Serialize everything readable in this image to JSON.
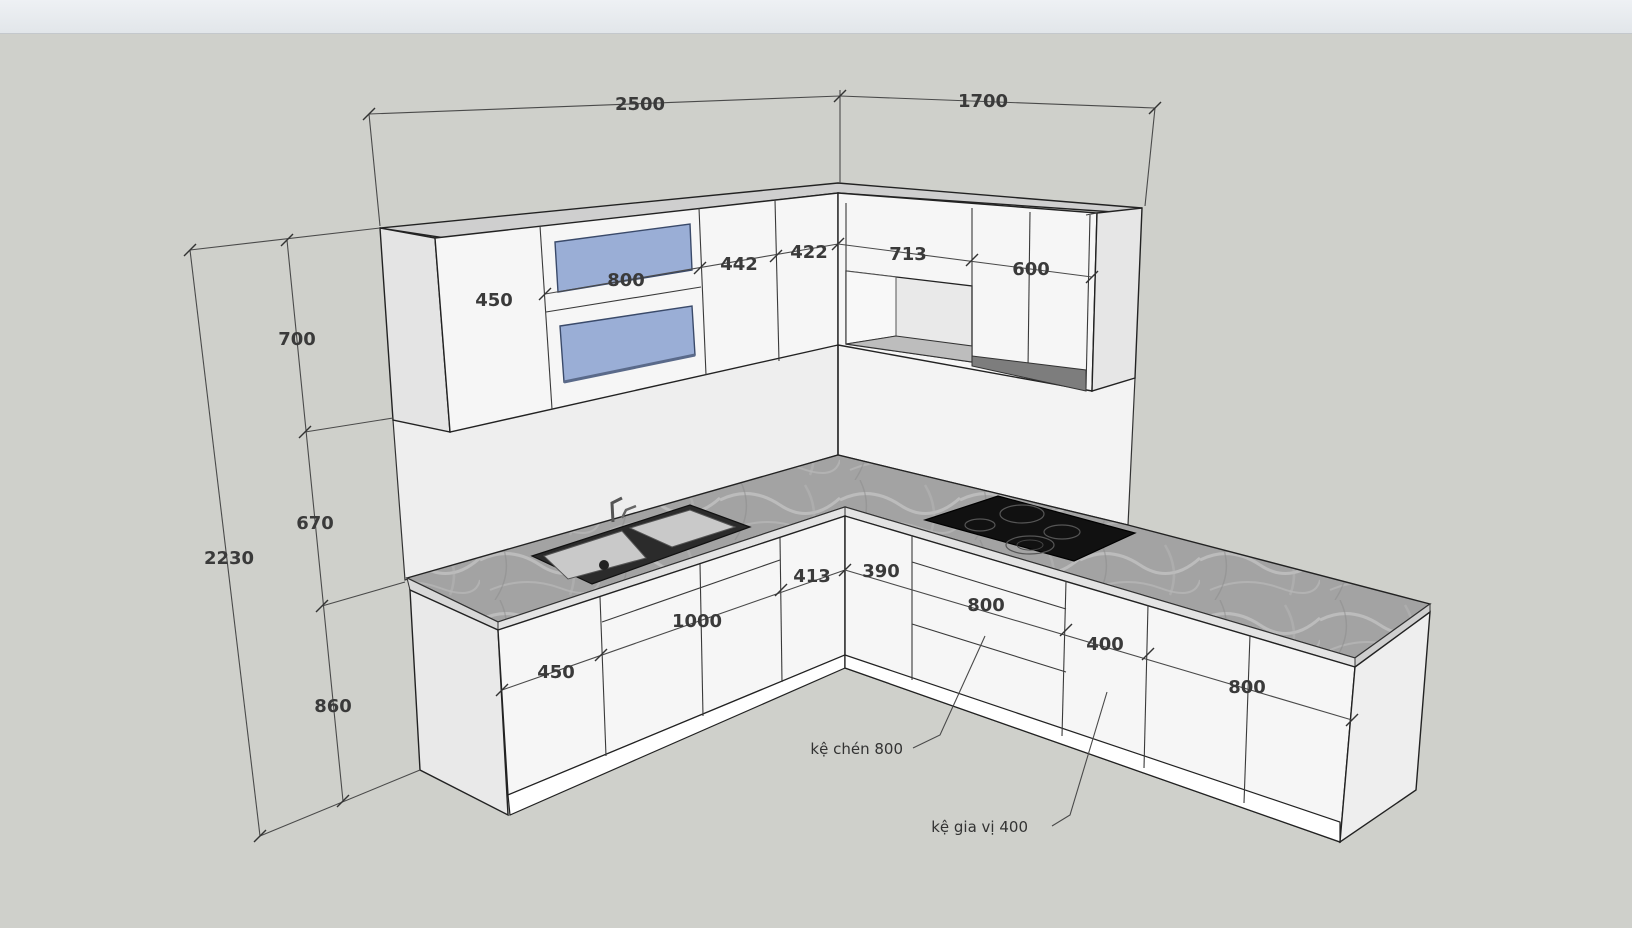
{
  "dimensions": {
    "width_wall_a": "2500",
    "width_wall_b": "1700",
    "total_height": "2230",
    "upper_height": "700",
    "gap_height": "670",
    "base_height": "860",
    "upper_450": "450",
    "upper_800": "800",
    "upper_442": "442",
    "upper_422": "422",
    "upper_713": "713",
    "upper_600": "600",
    "base_450": "450",
    "base_1000": "1000",
    "base_413": "413",
    "base_390": "390",
    "base_800_a": "800",
    "base_400": "400",
    "base_800_b": "800"
  },
  "notes": {
    "dish_rack": "kệ chén 800",
    "spice_rack": "kệ gia vị 400"
  },
  "colors": {
    "background": "#cfd0cb",
    "cabinet_white": "#f6f6f6",
    "glass_blue": "#9aaed6",
    "countertop": "#9a9a9a",
    "cooktop": "#111111"
  }
}
